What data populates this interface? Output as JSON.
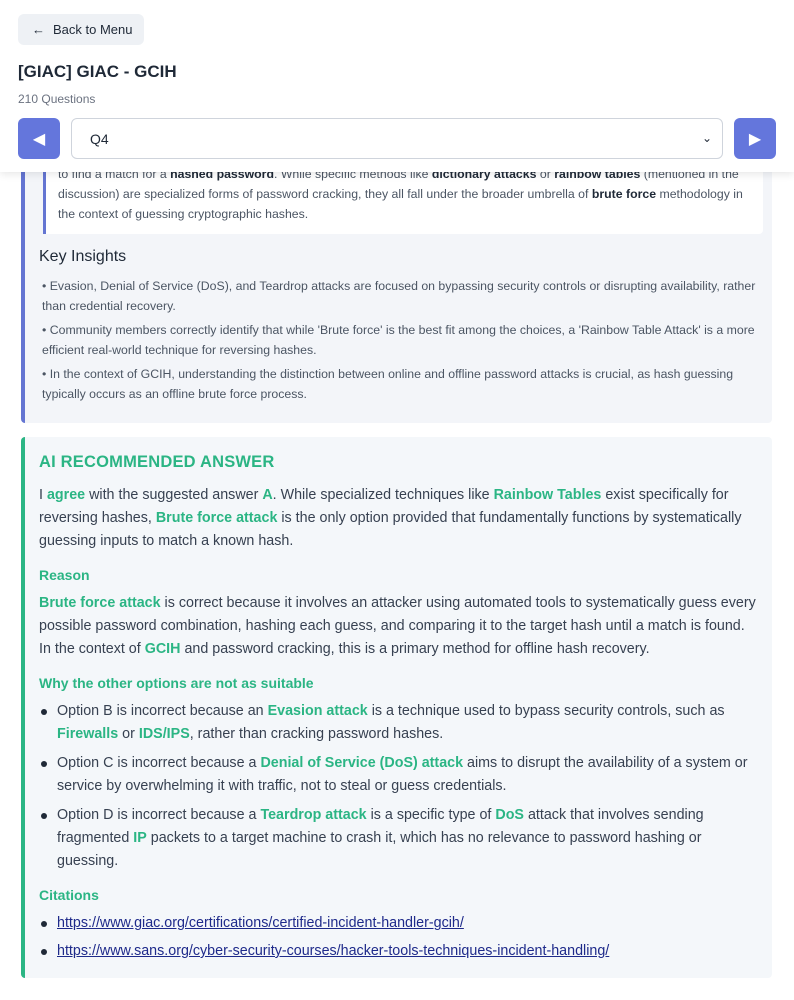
{
  "header": {
    "back_label": "Back to Menu",
    "title": "[GIAC] GIAC - GCIH",
    "question_count": "210 Questions",
    "selected_question": "Q4"
  },
  "summary": {
    "p1": "to find a match for a ",
    "b1": "hashed password",
    "p2": ". While specific methods like ",
    "b2": "dictionary attacks",
    "p3": " or ",
    "b3": "rainbow tables",
    "p4": " (mentioned in the discussion) are specialized forms of password cracking, they all fall under the broader umbrella of ",
    "b4": "brute force",
    "p5": " methodology in the context of guessing cryptographic hashes."
  },
  "insights": {
    "heading": "Key Insights",
    "items": [
      "• Evasion, Denial of Service (DoS), and Teardrop attacks are focused on bypassing security controls or disrupting availability, rather than credential recovery.",
      "• Community members correctly identify that while 'Brute force' is the best fit among the choices, a 'Rainbow Table Attack' is a more efficient real-world technique for reversing hashes.",
      "• In the context of GCIH, understanding the distinction between online and offline password attacks is crucial, as hash guessing typically occurs as an offline brute force process."
    ]
  },
  "ai": {
    "title": "AI RECOMMENDED ANSWER",
    "intro": {
      "t1": "I ",
      "h1": "agree",
      "t2": " with the suggested answer ",
      "h2": "A",
      "t3": ". While specialized techniques like ",
      "h3": "Rainbow Tables",
      "t4": " exist specifically for reversing hashes, ",
      "h4": "Brute force attack",
      "t5": " is the only option provided that fundamentally functions by systematically guessing inputs to match a known hash."
    },
    "reason_heading": "Reason",
    "reason": {
      "h1": "Brute force attack",
      "t1": " is correct because it involves an attacker using automated tools to systematically guess every possible password combination, hashing each guess, and comparing it to the target hash until a match is found. In the context of ",
      "h2": "GCIH",
      "t2": " and password cracking, this is a primary method for offline hash recovery."
    },
    "other_heading": "Why the other options are not as suitable",
    "options": {
      "b": {
        "t1": "Option B is incorrect because an ",
        "h1": "Evasion attack",
        "t2": " is a technique used to bypass security controls, such as ",
        "h2": "Firewalls",
        "t3": " or ",
        "h3": "IDS/IPS",
        "t4": ", rather than cracking password hashes."
      },
      "c": {
        "t1": "Option C is incorrect because a ",
        "h1": "Denial of Service (DoS) attack",
        "t2": " aims to disrupt the availability of a system or service by overwhelming it with traffic, not to steal or guess credentials."
      },
      "d": {
        "t1": "Option D is incorrect because a ",
        "h1": "Teardrop attack",
        "t2": " is a specific type of ",
        "h2": "DoS",
        "t3": " attack that involves sending fragmented ",
        "h3": "IP",
        "t4": " packets to a target machine to crash it, which has no relevance to password hashing or guessing."
      }
    },
    "citations_heading": "Citations",
    "citations": [
      "https://www.giac.org/certifications/certified-incident-handler-gcih/",
      "https://www.sans.org/cyber-security-courses/hacker-tools-techniques-incident-handling/"
    ]
  },
  "colors": {
    "accent_blue": "#6476dc",
    "accent_green": "#2bb584",
    "link": "#1e2a8a"
  },
  "icons": {
    "back": "arrow-left-icon",
    "prev": "triangle-left-icon",
    "next": "triangle-right-icon",
    "select": "chevron-down-icon"
  }
}
